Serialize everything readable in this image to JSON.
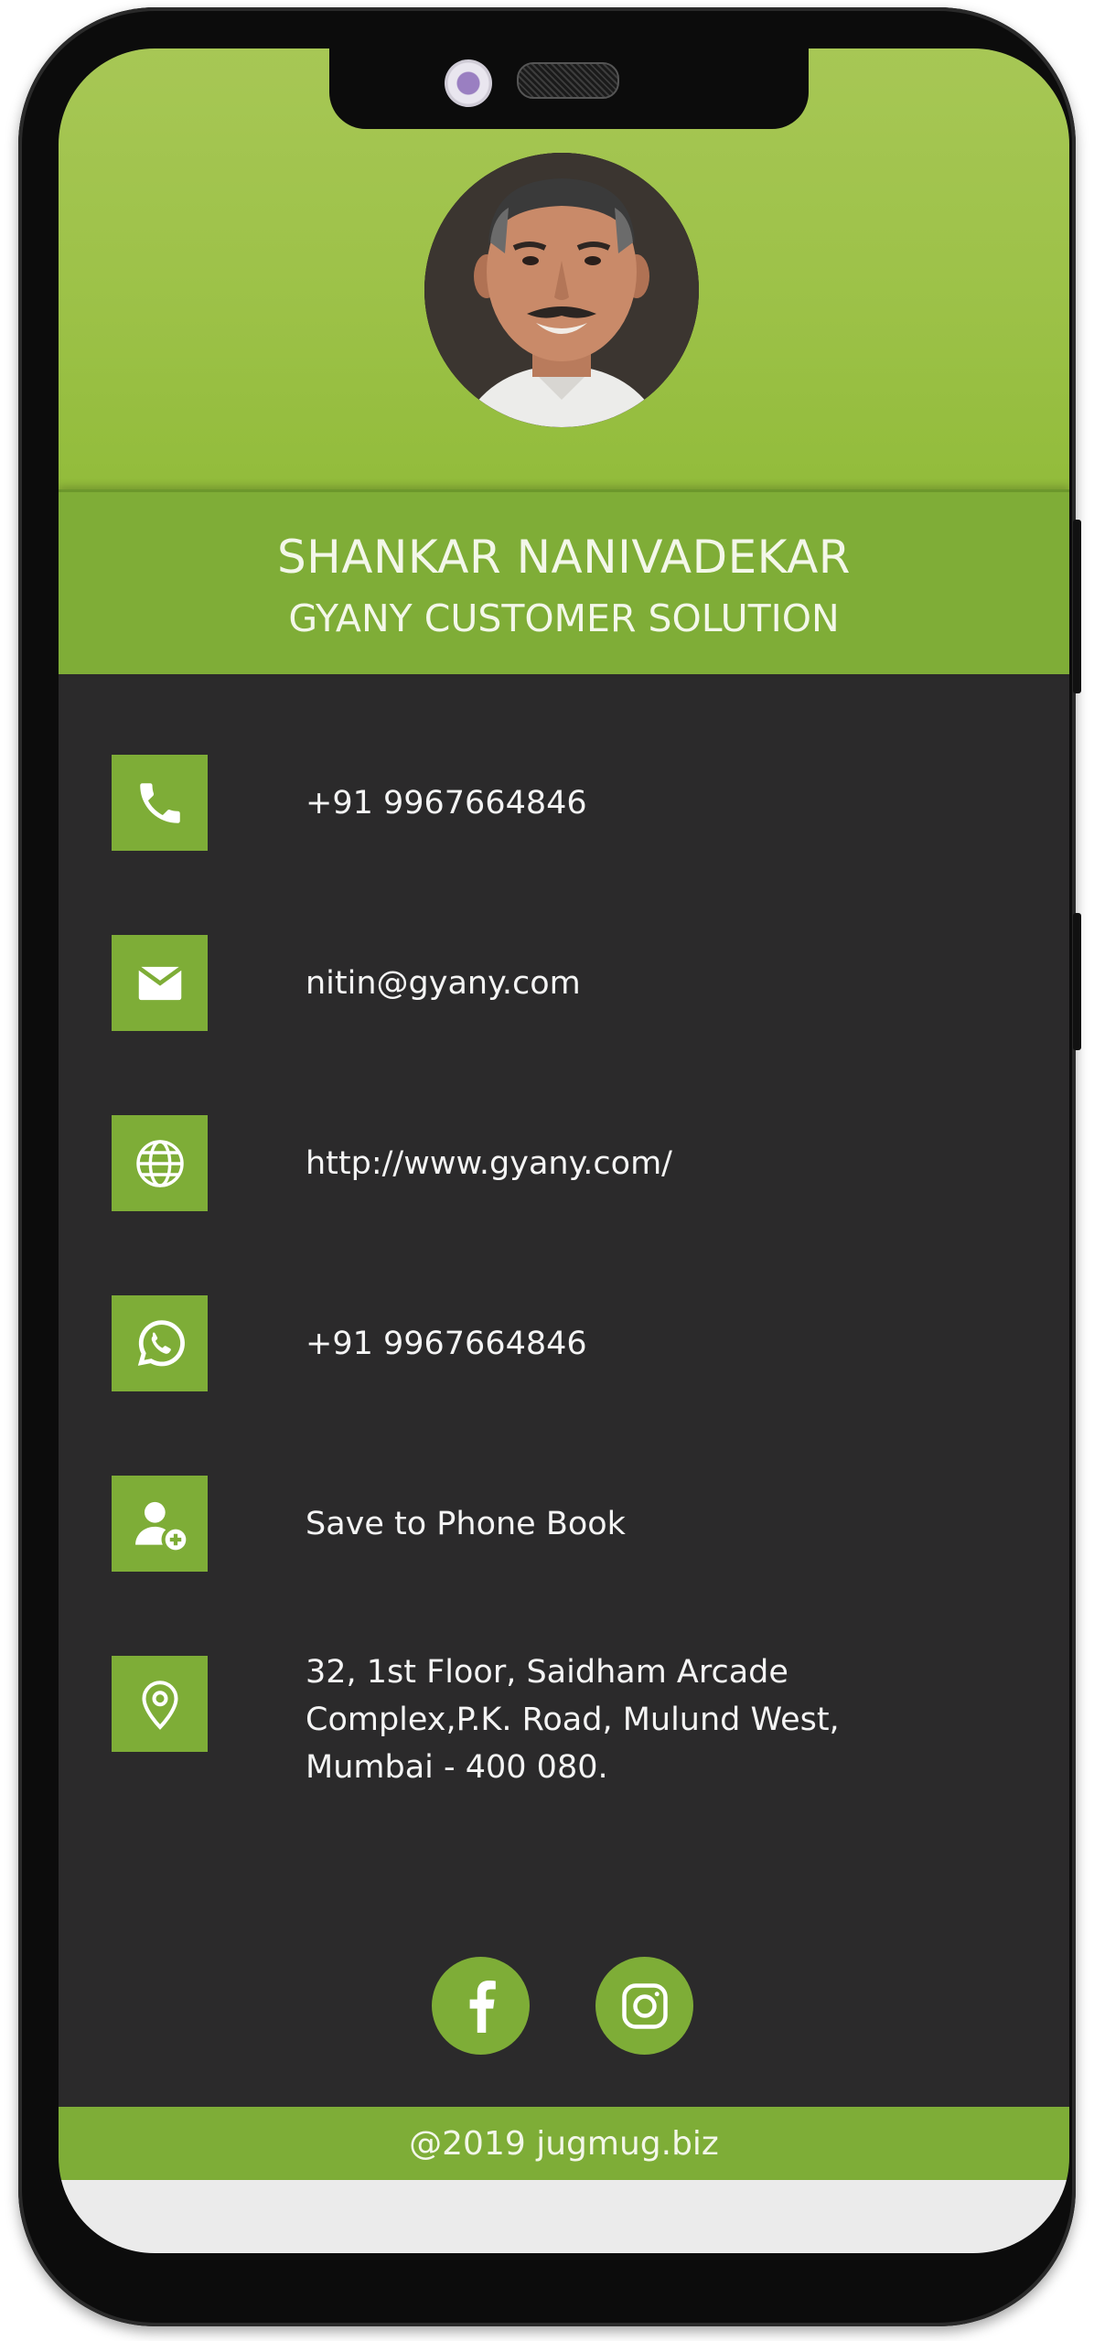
{
  "profile": {
    "name": "SHANKAR NANIVADEKAR",
    "company": "GYANY CUSTOMER SOLUTION",
    "avatar_icon": "person-photo"
  },
  "contacts": [
    {
      "icon": "phone-icon",
      "text": "+91 9967664846"
    },
    {
      "icon": "envelope-icon",
      "text": "nitin@gyany.com"
    },
    {
      "icon": "globe-icon",
      "text": "http://www.gyany.com/"
    },
    {
      "icon": "whatsapp-icon",
      "text": "+91 9967664846"
    },
    {
      "icon": "add-contact-icon",
      "text": "Save to Phone Book"
    },
    {
      "icon": "location-pin-icon",
      "text": "32, 1st Floor, Saidham Arcade Complex,P.K. Road, Mulund West, Mumbai - 400 080."
    }
  ],
  "social": [
    {
      "icon": "facebook-icon"
    },
    {
      "icon": "instagram-icon"
    }
  ],
  "footer": {
    "text": "@2019 jugmug.biz"
  },
  "colors": {
    "accent_green": "#7ead37",
    "header_green": "#a7c755",
    "body_dark": "#2b2a2b",
    "text_light": "#f4f4f4"
  }
}
